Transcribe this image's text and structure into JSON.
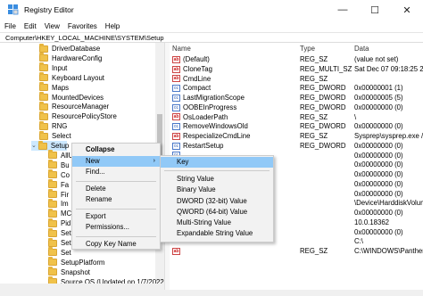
{
  "window": {
    "title": "Registry Editor",
    "minimize": "—",
    "maximize": "☐",
    "close": "✕"
  },
  "menu": [
    "File",
    "Edit",
    "View",
    "Favorites",
    "Help"
  ],
  "address": "Computer\\HKEY_LOCAL_MACHINE\\SYSTEM\\Setup",
  "tree": {
    "items": [
      {
        "label": "DriverDatabase",
        "indent": 0
      },
      {
        "label": "HardwareConfig",
        "indent": 0
      },
      {
        "label": "Input",
        "indent": 0
      },
      {
        "label": "Keyboard Layout",
        "indent": 0
      },
      {
        "label": "Maps",
        "indent": 0
      },
      {
        "label": "MountedDevices",
        "indent": 0
      },
      {
        "label": "ResourceManager",
        "indent": 0
      },
      {
        "label": "ResourcePolicyStore",
        "indent": 0
      },
      {
        "label": "RNG",
        "indent": 0
      },
      {
        "label": "Select",
        "indent": 0
      },
      {
        "label": "Setup",
        "indent": 0,
        "expanded": true,
        "selected": true
      },
      {
        "label": "AllU",
        "indent": 1
      },
      {
        "label": "Bu",
        "indent": 1
      },
      {
        "label": "Co",
        "indent": 1
      },
      {
        "label": "Fa",
        "indent": 1
      },
      {
        "label": "Fir",
        "indent": 1
      },
      {
        "label": "Im",
        "indent": 1
      },
      {
        "label": "MC",
        "indent": 1
      },
      {
        "label": "Pid",
        "indent": 1
      },
      {
        "label": "Set",
        "indent": 1
      },
      {
        "label": "Set",
        "indent": 1
      },
      {
        "label": "Set",
        "indent": 1
      },
      {
        "label": "SetupPlatform",
        "indent": 1
      },
      {
        "label": "Snapshot",
        "indent": 1
      },
      {
        "label": "Source OS (Updated on 1/7/2022 1",
        "indent": 1
      }
    ]
  },
  "values": {
    "headers": {
      "name": "Name",
      "type": "Type",
      "data": "Data"
    },
    "rows": [
      {
        "icon": "ab",
        "name": "(Default)",
        "type": "REG_SZ",
        "data": "(value not set)"
      },
      {
        "icon": "ab",
        "name": "CloneTag",
        "type": "REG_MULTI_SZ",
        "data": "Sat Dec 07 09:18:25 201"
      },
      {
        "icon": "ab",
        "name": "CmdLine",
        "type": "REG_SZ",
        "data": ""
      },
      {
        "icon": "bin",
        "name": "Compact",
        "type": "REG_DWORD",
        "data": "0x00000001 (1)"
      },
      {
        "icon": "bin",
        "name": "LastMigrationScope",
        "type": "REG_DWORD",
        "data": "0x00000005 (5)"
      },
      {
        "icon": "bin",
        "name": "OOBEInProgress",
        "type": "REG_DWORD",
        "data": "0x00000000 (0)"
      },
      {
        "icon": "ab",
        "name": "OsLoaderPath",
        "type": "REG_SZ",
        "data": "\\"
      },
      {
        "icon": "bin",
        "name": "RemoveWindowsOld",
        "type": "REG_DWORD",
        "data": "0x00000000 (0)"
      },
      {
        "icon": "ab",
        "name": "RespecializeCmdLine",
        "type": "REG_SZ",
        "data": "Sysprep\\sysprep.exe /re"
      },
      {
        "icon": "bin",
        "name": "RestartSetup",
        "type": "REG_DWORD",
        "data": "0x00000000 (0)"
      },
      {
        "icon": "bin",
        "name": "",
        "type": "",
        "data": "0x00000000 (0)"
      },
      {
        "icon": "",
        "name": "",
        "type": "",
        "data": "0x00000000 (0)"
      },
      {
        "icon": "",
        "name": "",
        "type": "",
        "data": "0x00000000 (0)"
      },
      {
        "icon": "",
        "name": "",
        "type": "",
        "data": "0x00000000 (0)"
      },
      {
        "icon": "",
        "name": "",
        "type": "",
        "data": "0x00000000 (0)"
      },
      {
        "icon": "",
        "name": "",
        "type": "",
        "data": "\\Device\\HarddiskVolum"
      },
      {
        "icon": "",
        "name": "",
        "type": "",
        "data": "0x00000000 (0)"
      },
      {
        "icon": "",
        "name": "",
        "type": "",
        "data": "10.0.18362"
      },
      {
        "icon": "",
        "name": "",
        "type": "",
        "data": "0x00000000 (0)"
      },
      {
        "icon": "",
        "name": "",
        "type": "",
        "data": "C:\\"
      },
      {
        "icon": "ab",
        "name": "",
        "type": "REG_SZ",
        "data": "C:\\WINDOWS\\Panther"
      }
    ]
  },
  "context_menu": {
    "items": [
      {
        "label": "Collapse",
        "bold": true
      },
      {
        "label": "New",
        "submenu": true,
        "highlight": true
      },
      {
        "label": "Find..."
      },
      {
        "sep": true
      },
      {
        "label": "Delete"
      },
      {
        "label": "Rename"
      },
      {
        "sep": true
      },
      {
        "label": "Export"
      },
      {
        "label": "Permissions..."
      },
      {
        "sep": true
      },
      {
        "label": "Copy Key Name"
      }
    ],
    "submenu_arrow": "›"
  },
  "submenu": {
    "items": [
      {
        "label": "Key",
        "highlight": true
      },
      {
        "sep": true
      },
      {
        "label": "String Value"
      },
      {
        "label": "Binary Value"
      },
      {
        "label": "DWORD (32-bit) Value"
      },
      {
        "label": "QWORD (64-bit) Value"
      },
      {
        "label": "Multi-String Value"
      },
      {
        "label": "Expandable String Value"
      }
    ]
  },
  "colors": {
    "selection": "#cce8ff",
    "menu_highlight": "#91c9f7",
    "folder": "#f0c24a"
  }
}
